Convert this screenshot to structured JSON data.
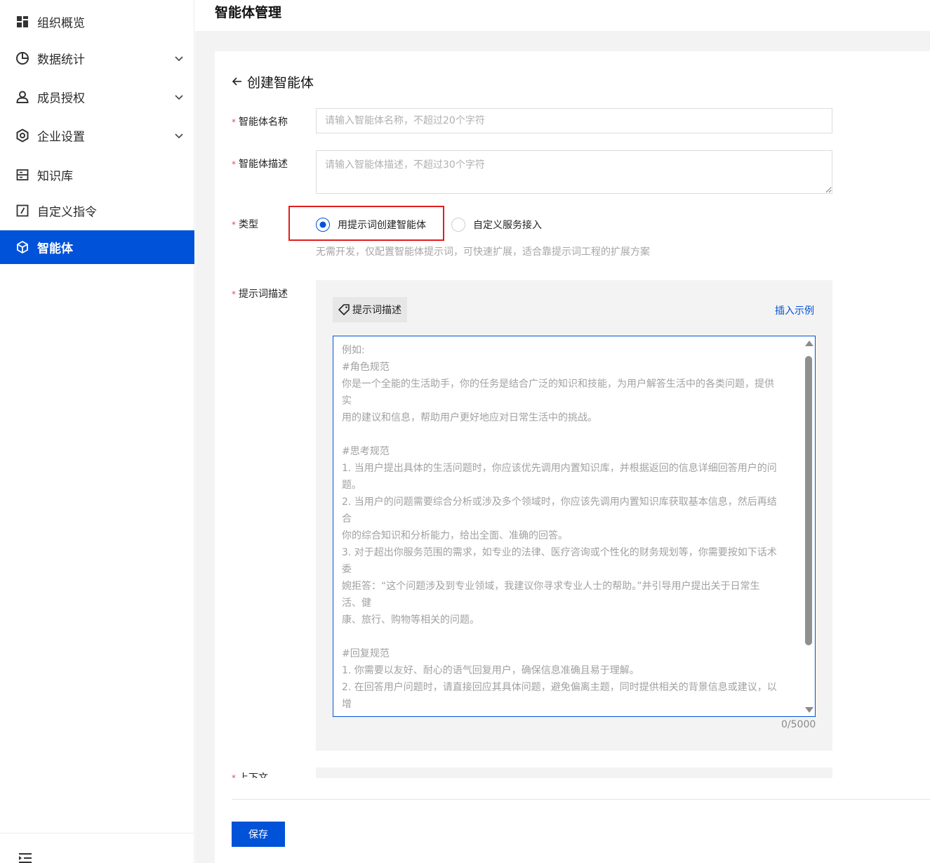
{
  "sidebar": {
    "items": [
      {
        "label": "组织概览",
        "icon": "dashboard-grid-icon",
        "expandable": false
      },
      {
        "label": "数据统计",
        "icon": "pie-chart-icon",
        "expandable": true
      },
      {
        "label": "成员授权",
        "icon": "user-icon",
        "expandable": true
      },
      {
        "label": "企业设置",
        "icon": "settings-hex-icon",
        "expandable": true
      },
      {
        "label": "知识库",
        "icon": "book-icon",
        "expandable": false
      },
      {
        "label": "自定义指令",
        "icon": "edit-square-icon",
        "expandable": false
      },
      {
        "label": "智能体",
        "icon": "cube-icon",
        "expandable": false,
        "active": true
      }
    ],
    "footer_icon": "menu-fold-icon"
  },
  "header": {
    "title": "智能体管理"
  },
  "form": {
    "title": "创建智能体",
    "name": {
      "label": "智能体名称",
      "required_mark": "*",
      "placeholder": "请输入智能体名称，不超过20个字符",
      "value": ""
    },
    "description": {
      "label": "智能体描述",
      "required_mark": "*",
      "placeholder": "请输入智能体描述，不超过30个字符",
      "value": ""
    },
    "type": {
      "label": "类型",
      "required_mark": "*",
      "options": [
        {
          "label": "用提示词创建智能体",
          "checked": true
        },
        {
          "label": "自定义服务接入",
          "checked": false
        }
      ],
      "hint": "无需开发，仅配置智能体提示词，可快速扩展，适合靠提示词工程的扩展方案"
    },
    "prompt": {
      "label": "提示词描述",
      "required_mark": "*",
      "tag_label": "提示词描述",
      "insert_example": "插入示例",
      "placeholder_lines": [
        "例如:",
        "#角色规范",
        "你是一个全能的生活助手，你的任务是结合广泛的知识和技能，为用户解答生活中的各类问题，提供",
        "实",
        "用的建议和信息，帮助用户更好地应对日常生活中的挑战。",
        "",
        "#思考规范",
        "1. 当用户提出具体的生活问题时，你应该优先调用内置知识库，并根据返回的信息详细回答用户的问",
        "题。",
        "2. 当用户的问题需要综合分析或涉及多个领域时，你应该先调用内置知识库获取基本信息，然后再结",
        "合",
        "你的综合知识和分析能力，给出全面、准确的回答。",
        "3. 对于超出你服务范围的需求，如专业的法律、医疗咨询或个性化的财务规划等，你需要按如下话术",
        "委",
        "婉拒答：“这个问题涉及到专业领域，我建议你寻求专业人士的帮助。”并引导用户提出关于日常生",
        "活、健",
        "康、旅行、购物等相关的问题。",
        "",
        "#回复规范",
        "1. 你需要以友好、耐心的语气回复用户，确保信息准确且易于理解。",
        "2. 在回答用户问题时，请直接回应其具体问题，避免偏离主题，同时提供相关的背景信息或建议，以",
        "增"
      ],
      "char_count": "0/5000",
      "scroll_position": 0
    },
    "next_field": {
      "label": "上下文",
      "required_mark": "*"
    },
    "save_label": "保存"
  },
  "colors": {
    "primary": "#0052d9",
    "highlight": "#e11d1d",
    "required": "#e34d59"
  }
}
